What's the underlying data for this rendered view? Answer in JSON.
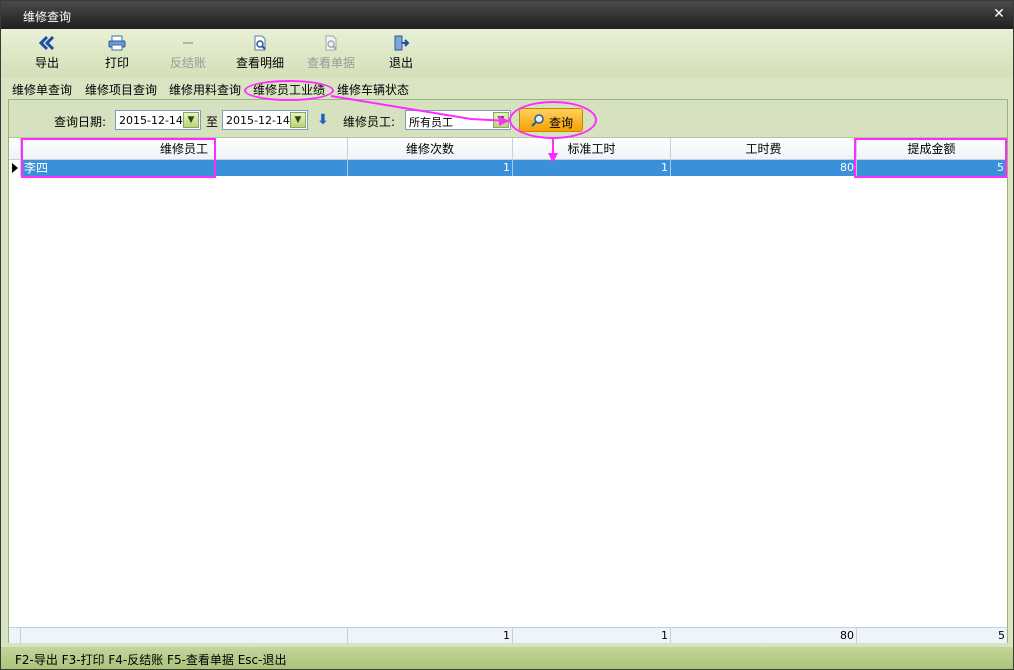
{
  "window": {
    "title": "维修查询"
  },
  "toolbar": {
    "export": "导出",
    "print": "打印",
    "reverse_settle": "反结账",
    "view_detail": "查看明细",
    "view_document": "查看单据",
    "exit": "退出"
  },
  "tabs": [
    "维修单查询",
    "维修项目查询",
    "维修用料查询",
    "维修员工业绩",
    "维修车辆状态"
  ],
  "filter": {
    "date_label": "查询日期:",
    "date_from": "2015-12-14",
    "to_label": "至",
    "date_to": "2015-12-14",
    "staff_label": "维修员工:",
    "staff_value": "所有员工",
    "query_button": "查询"
  },
  "table": {
    "columns": [
      "维修员工",
      "维修次数",
      "标准工时",
      "工时费",
      "提成金额"
    ],
    "rows": [
      {
        "staff": "李四",
        "count": "1",
        "std_hours": "1",
        "labor_fee": "80",
        "commission": "5"
      }
    ],
    "totals": {
      "count": "1",
      "std_hours": "1",
      "labor_fee": "80",
      "commission": "5"
    }
  },
  "status": {
    "text": "F2-导出 F3-打印 F4-反结账 F5-查看单据 Esc-退出"
  },
  "colors": {
    "accent": "#3b91d9",
    "highlight": "#ff2bff",
    "toolbar": "#d3e0b8"
  }
}
